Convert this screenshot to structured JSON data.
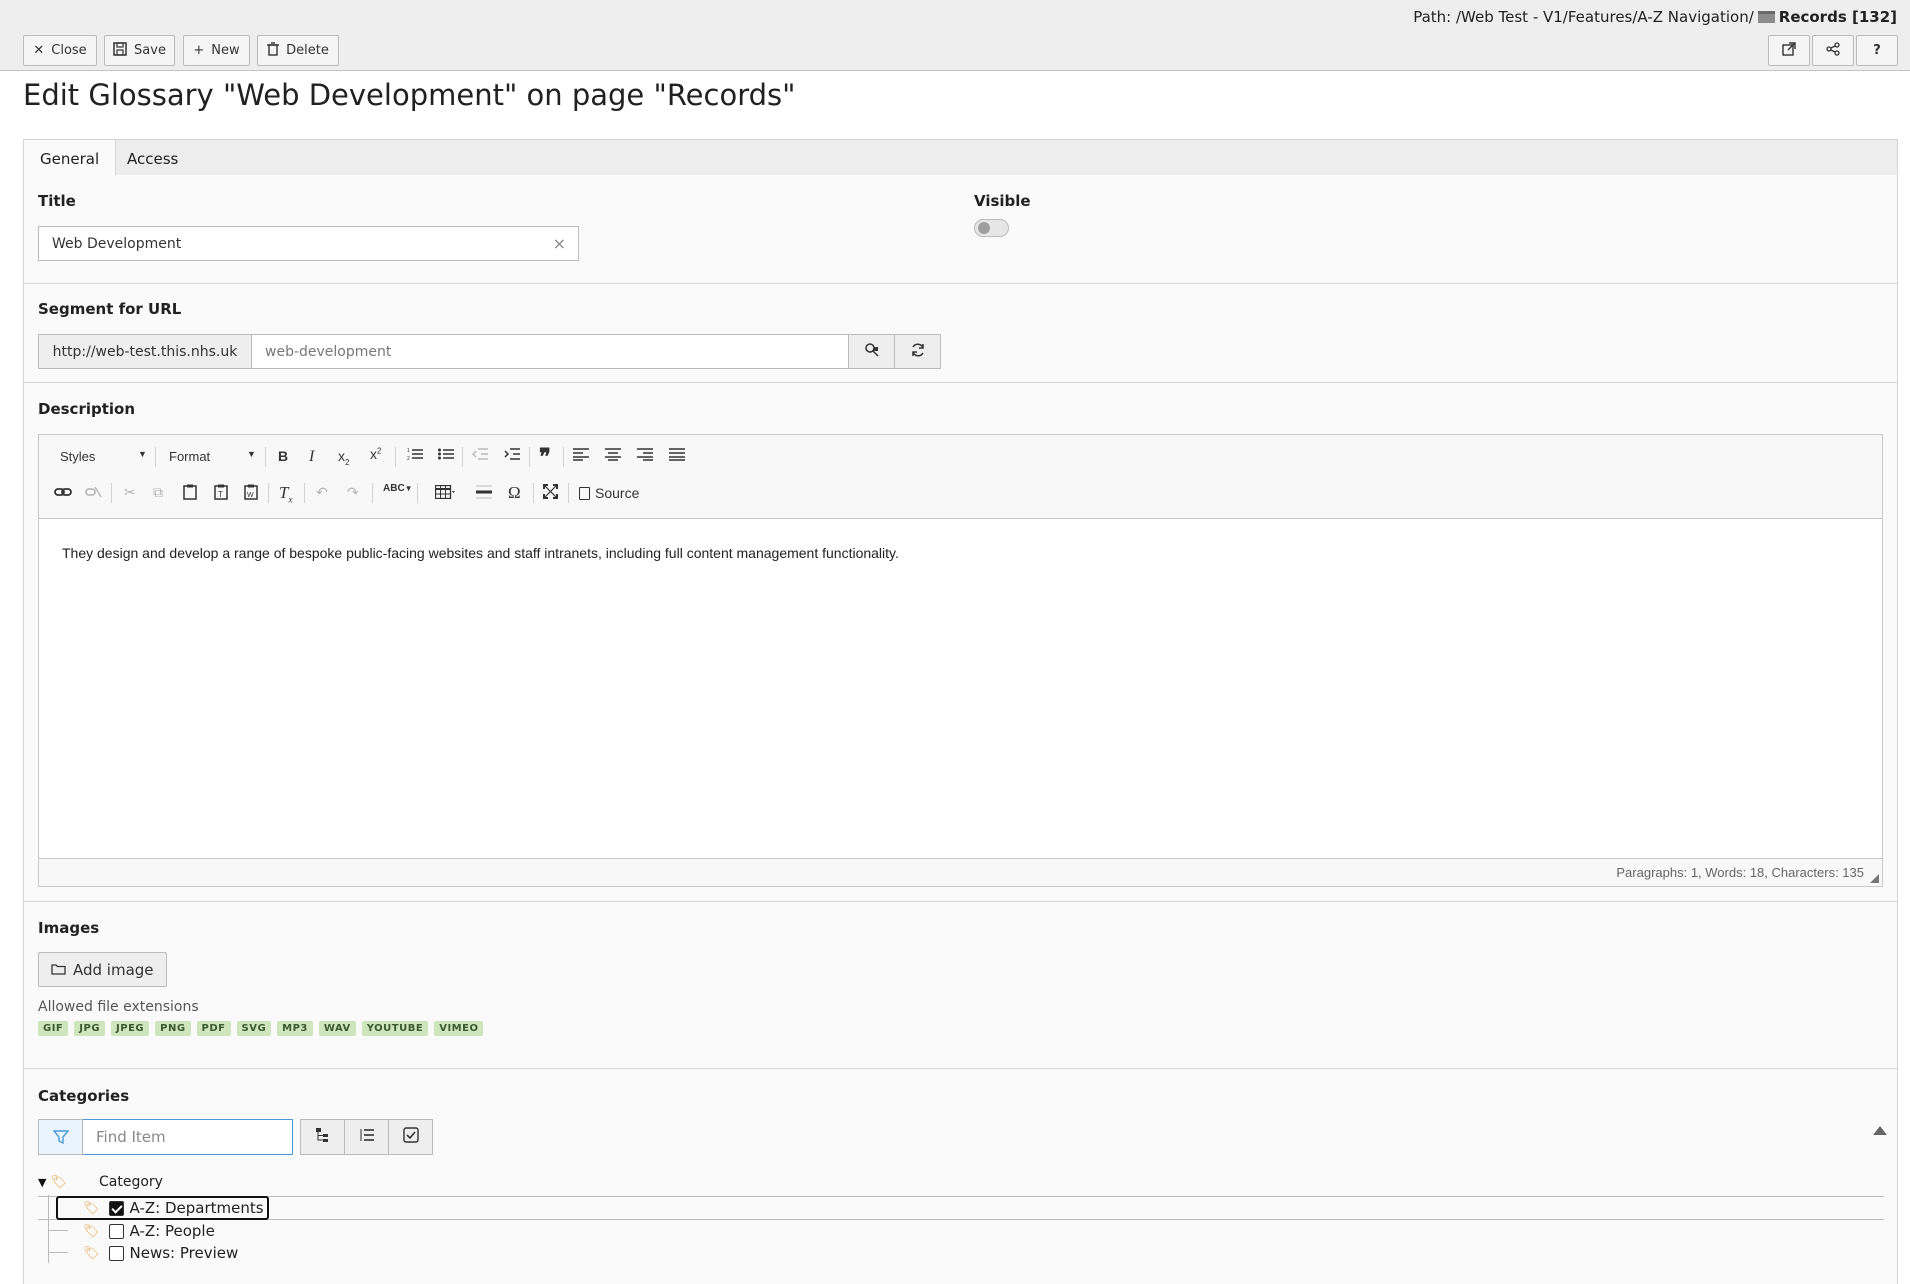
{
  "header": {
    "path_prefix": "Path: /Web Test - V1/Features/A-Z Navigation/",
    "path_page": "Records [132]",
    "buttons": {
      "close": "Close",
      "save": "Save",
      "new": "New",
      "delete": "Delete"
    },
    "icon_buttons": [
      "external-link-icon",
      "share-icon",
      "help-icon"
    ],
    "help_label": "?"
  },
  "title": "Edit Glossary \"Web Development\" on page \"Records\"",
  "tabs": [
    {
      "label": "General",
      "active": true
    },
    {
      "label": "Access",
      "active": false
    }
  ],
  "fields": {
    "title_label": "Title",
    "title_value": "Web Development",
    "visible_label": "Visible",
    "visible_on": false,
    "segment_label": "Segment for URL",
    "segment_prefix": "http://web-test.this.nhs.uk",
    "segment_value": "web-development",
    "description_label": "Description"
  },
  "editor": {
    "styles_label": "Styles",
    "format_label": "Format",
    "source_label": "Source",
    "content": "They design and develop a range of bespoke public-facing websites and staff intranets, including full content management functionality.",
    "status": "Paragraphs: 1, Words: 18, Characters: 135"
  },
  "images": {
    "label": "Images",
    "add_button": "Add image",
    "allowed_label": "Allowed file extensions",
    "extensions": [
      "GIF",
      "JPG",
      "JPEG",
      "PNG",
      "PDF",
      "SVG",
      "MP3",
      "WAV",
      "YOUTUBE",
      "VIMEO"
    ]
  },
  "categories": {
    "label": "Categories",
    "filter_placeholder": "Find Item",
    "root": "Category",
    "items": [
      {
        "label": "A-Z: Departments",
        "checked": true
      },
      {
        "label": "A-Z: People",
        "checked": false
      },
      {
        "label": "News: Preview",
        "checked": false
      }
    ]
  }
}
